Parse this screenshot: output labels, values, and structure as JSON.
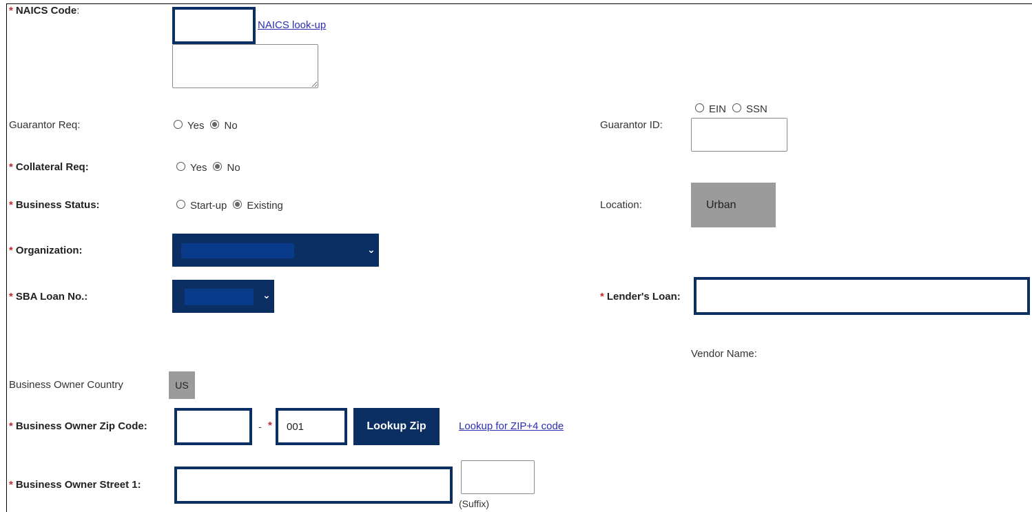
{
  "naics": {
    "label": "NAICS Code",
    "colon": ":",
    "lookup_link": "NAICS look-up"
  },
  "guarantor_req": {
    "label": "Guarantor Req:",
    "options": [
      "Yes",
      "No"
    ],
    "selected": "No"
  },
  "guarantor_id": {
    "label": "Guarantor ID:",
    "options": [
      "EIN",
      "SSN"
    ],
    "selected": ""
  },
  "collateral_req": {
    "label": "Collateral Req:",
    "options": [
      "Yes",
      "No"
    ],
    "selected": "No"
  },
  "business_status": {
    "label": "Business Status:",
    "options": [
      "Start-up",
      "Existing"
    ],
    "selected": "Existing"
  },
  "location": {
    "label": "Location:",
    "value": "Urban"
  },
  "organization": {
    "label": "Organization:"
  },
  "sba_loan": {
    "label": "SBA Loan No.:"
  },
  "lenders_loan": {
    "label": "Lender's Loan:"
  },
  "vendor": {
    "label": "Vendor Name:"
  },
  "owner_country": {
    "label": "Business Owner Country",
    "value": "US"
  },
  "owner_zip": {
    "label": "Business Owner Zip Code:",
    "dash": "-",
    "zip4_value": "001",
    "lookup_button": "Lookup Zip",
    "zip4_link": "Lookup for ZIP+4 code"
  },
  "owner_street": {
    "label": "Business Owner Street 1:",
    "suffix_label": "(Suffix)"
  },
  "required_mark": "*",
  "colors": {
    "accent_navy": "#0b2e63",
    "required_red": "#c1272d",
    "link_blue": "#2b2bb5",
    "readonly_gray": "#9b9b9b"
  }
}
